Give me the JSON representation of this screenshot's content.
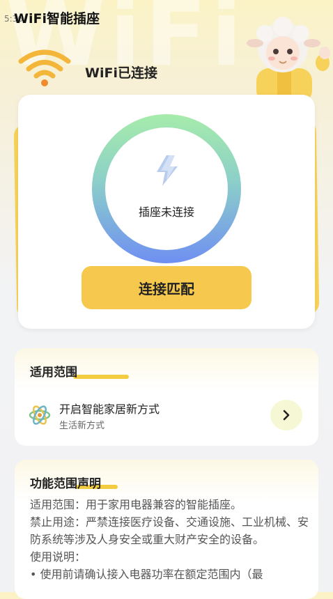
{
  "status_bar": {
    "time": "5:36"
  },
  "app": {
    "title": "WiFi智能插座",
    "watermark": "WiFi"
  },
  "wifi": {
    "status_text": "WiFi已连接",
    "icon": "wifi-icon",
    "color": "#f3b63a"
  },
  "device": {
    "socket_status": "插座未连接",
    "connect_button": "连接匹配",
    "ring_colors": [
      "#a6ecaa",
      "#6f8ff2"
    ]
  },
  "scope": {
    "title": "适用范围",
    "item_title": "开启智能家居新方式",
    "item_subtitle": "生活新方式"
  },
  "declaration": {
    "title": "功能范围声明",
    "lines": [
      "适用范围：用于家用电器兼容的智能插座。",
      "禁止用途：严禁连接医疗设备、交通设施、工业机械、安防系统等涉及人身安全或重大财产安全的设备。",
      "使用说明：",
      "• 使用前请确认接入电器功率在额定范围内（最"
    ]
  },
  "colors": {
    "accent": "#f6c94e",
    "card_shadow": "#f6d35a"
  }
}
